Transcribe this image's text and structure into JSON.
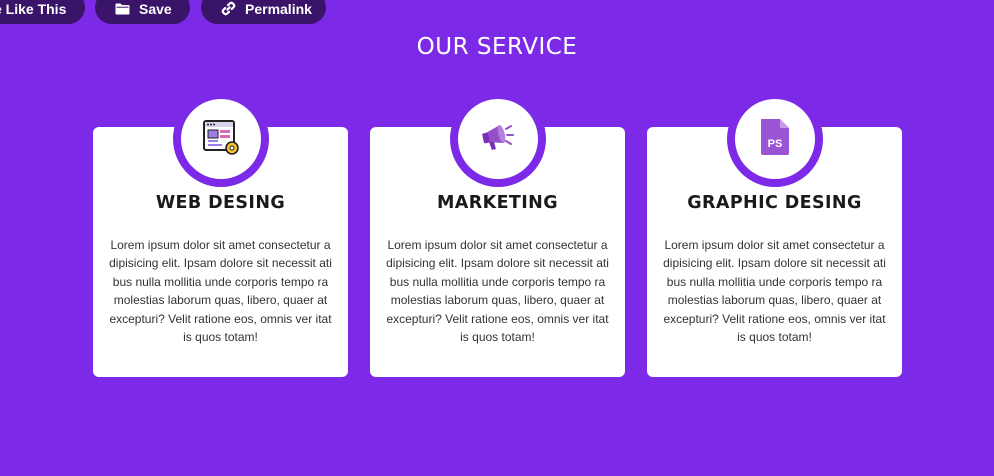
{
  "top_buttons": {
    "like": "e Like This",
    "save": "Save",
    "permalink": "Permalink"
  },
  "section_title": "OUR SERVICE",
  "cards": [
    {
      "icon": "web-design-icon",
      "title": "WEB DESING",
      "text": "Lorem ipsum dolor sit amet consectetur adipisicing elit. Ipsam dolore sit necessit atibus nulla mollitia unde corporis tempo ra molestias laborum quas, libero, quaer at excepturi? Velit ratione eos, omnis ver itatis quos totam!"
    },
    {
      "icon": "megaphone-icon",
      "title": "MARKETING",
      "text": "Lorem ipsum dolor sit amet consectetur adipisicing elit. Ipsam dolore sit necessit atibus nulla mollitia unde corporis tempo ra molestias laborum quas, libero, quaer at excepturi? Velit ratione eos, omnis ver itatis quos totam!"
    },
    {
      "icon": "photoshop-file-icon",
      "icon_label": "PS",
      "title": "GRAPHIC DESING",
      "text": "Lorem ipsum dolor sit amet consectetur adipisicing elit. Ipsam dolore sit necessit atibus nulla mollitia unde corporis tempo ra molestias laborum quas, libero, quaer at excepturi? Velit ratione eos, omnis ver itatis quos totam!"
    }
  ],
  "colors": {
    "background": "#7d2ae8",
    "pill": "#3a1468",
    "card": "#ffffff",
    "icon_purple": "#8e44c9"
  }
}
